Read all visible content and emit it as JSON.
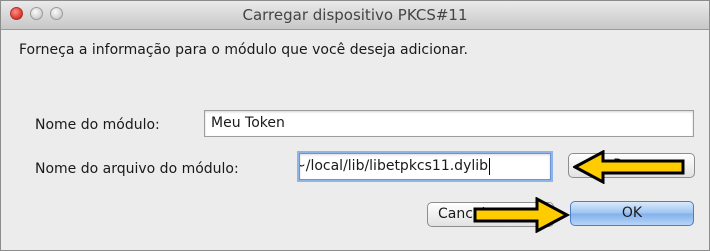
{
  "window": {
    "title": "Carregar dispositivo PKCS#11"
  },
  "dialog": {
    "instruction": "Forneça a informação para o módulo que você deseja adicionar.",
    "module_name_label": "Nome do módulo:",
    "module_name_value": "Meu Token",
    "module_file_label": "Nome do arquivo do módulo:",
    "module_file_value": "~/local/lib/libetpkcs11.dylib",
    "browse_label": "Procurar...",
    "cancel_label": "Cancelar",
    "ok_label": "OK"
  },
  "annotations": {
    "arrow_fill": "#ffcc00",
    "arrow_outline": "#000000"
  }
}
